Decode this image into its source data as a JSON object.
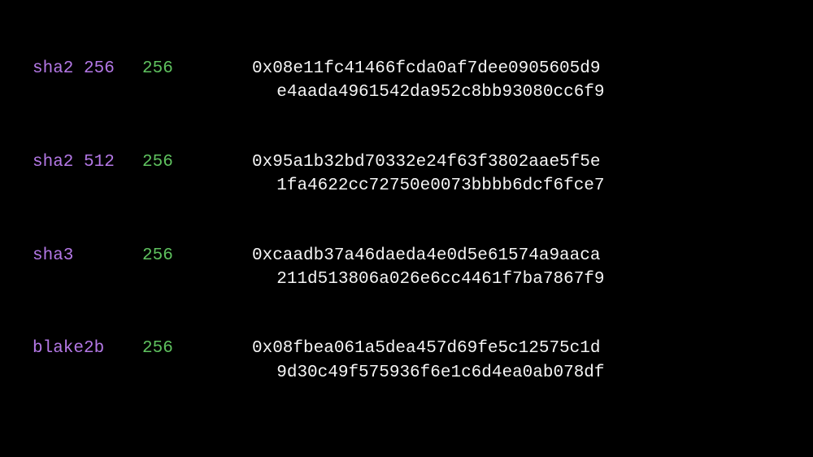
{
  "hashes": [
    {
      "algo": "sha2 256",
      "bits": "256",
      "line1": "0x08e11fc41466fcda0af7dee0905605d9",
      "line2": "e4aada4961542da952c8bb93080cc6f9"
    },
    {
      "algo": "sha2 512",
      "bits": "256",
      "line1": "0x95a1b32bd70332e24f63f3802aae5f5e",
      "line2": "1fa4622cc72750e0073bbbb6dcf6fce7"
    },
    {
      "algo": "sha3",
      "bits": "256",
      "line1": "0xcaadb37a46daeda4e0d5e61574a9aaca",
      "line2": "211d513806a026e6cc4461f7ba7867f9"
    },
    {
      "algo": "blake2b",
      "bits": "256",
      "line1": "0x08fbea061a5dea457d69fe5c12575c1d",
      "line2": "9d30c49f575936f6e1c6d4ea0ab078df"
    }
  ]
}
